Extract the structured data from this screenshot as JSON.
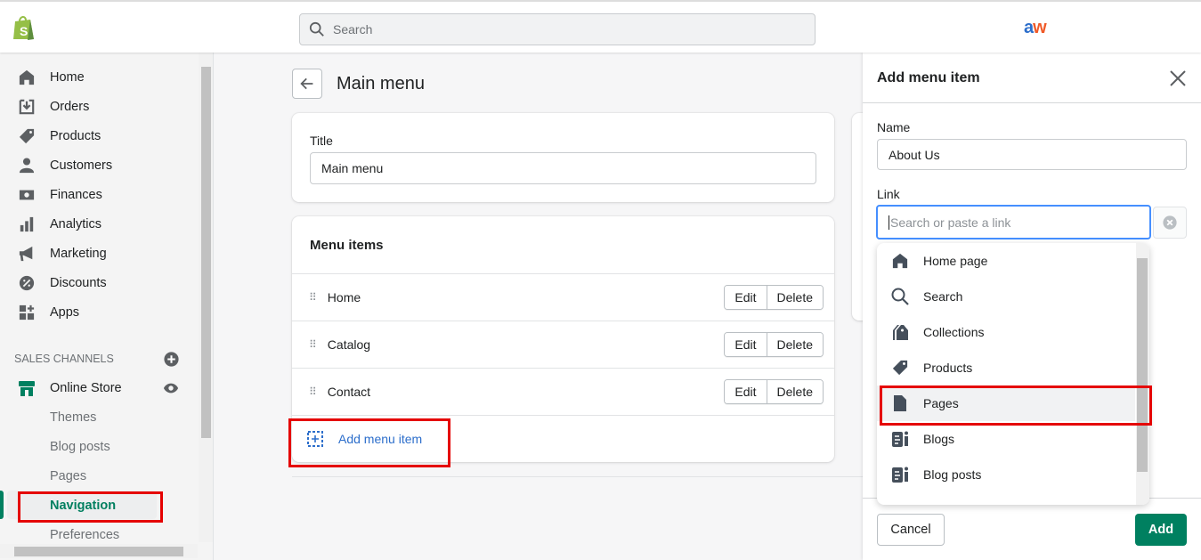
{
  "topbar": {
    "search_placeholder": "Search",
    "logo_text_a": "a",
    "logo_text_w": "w"
  },
  "sidebar": {
    "items": [
      {
        "label": "Home"
      },
      {
        "label": "Orders"
      },
      {
        "label": "Products"
      },
      {
        "label": "Customers"
      },
      {
        "label": "Finances"
      },
      {
        "label": "Analytics"
      },
      {
        "label": "Marketing"
      },
      {
        "label": "Discounts"
      },
      {
        "label": "Apps"
      }
    ],
    "sales_channels_heading": "SALES CHANNELS",
    "online_store": "Online Store",
    "sub_items": [
      {
        "label": "Themes"
      },
      {
        "label": "Blog posts"
      },
      {
        "label": "Pages"
      },
      {
        "label": "Navigation",
        "active": true
      },
      {
        "label": "Preferences"
      }
    ]
  },
  "main": {
    "page_title": "Main menu",
    "title_label": "Title",
    "title_value": "Main menu",
    "menu_items_heading": "Menu items",
    "menu_items": [
      {
        "label": "Home"
      },
      {
        "label": "Catalog"
      },
      {
        "label": "Contact"
      }
    ],
    "edit_label": "Edit",
    "delete_label": "Delete",
    "add_menu_item": "Add menu item"
  },
  "panel": {
    "title": "Add menu item",
    "name_label": "Name",
    "name_value": "About Us",
    "link_label": "Link",
    "link_placeholder": "Search or paste a link",
    "options": [
      {
        "label": "Home page",
        "icon": "home-icon"
      },
      {
        "label": "Search",
        "icon": "search-icon"
      },
      {
        "label": "Collections",
        "icon": "collections-icon"
      },
      {
        "label": "Products",
        "icon": "tag-icon"
      },
      {
        "label": "Pages",
        "icon": "page-icon",
        "highlighted": true
      },
      {
        "label": "Blogs",
        "icon": "blog-icon"
      },
      {
        "label": "Blog posts",
        "icon": "blog-icon"
      }
    ],
    "cancel_label": "Cancel",
    "add_label": "Add"
  },
  "colors": {
    "brand_green": "#008060",
    "highlight_red": "#e50000",
    "link_blue": "#2c6ecb",
    "focus_blue": "#458fff"
  }
}
